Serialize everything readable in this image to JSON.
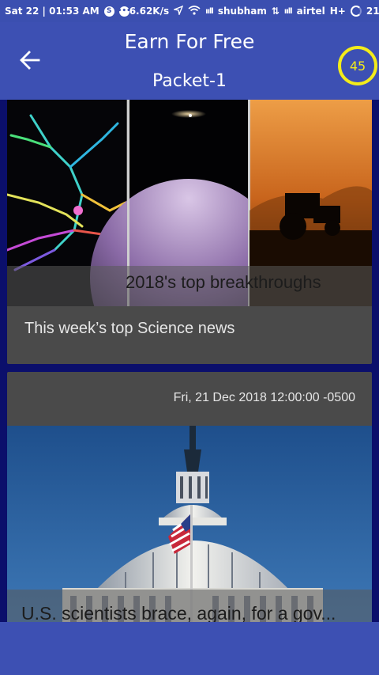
{
  "status_bar": {
    "time": "Sat 22 | 01:53 AM",
    "speed": "6.62K/s",
    "carrier_1": "shubham",
    "carrier_2": "airtel",
    "network_type": "H+",
    "battery": "21%"
  },
  "header": {
    "title": "Earn For Free",
    "subtitle": "Packet-1",
    "coins": "45"
  },
  "feed": {
    "cards": [
      {
        "overlay_title": "2018's top breakthroughs",
        "caption": "This week’s top Science news"
      },
      {
        "date": "Fri, 21 Dec 2018 12:00:00 -0500",
        "overlay_title": "U.S. scientists brace, again, for a gov..."
      }
    ]
  },
  "colors": {
    "primary": "#3d50b3",
    "background": "#0b0f6b",
    "card": "#4a4a4a",
    "badge_ring": "#f3ec1a"
  },
  "icons": {
    "back": "arrow-left-icon",
    "badge": "coin-counter"
  }
}
